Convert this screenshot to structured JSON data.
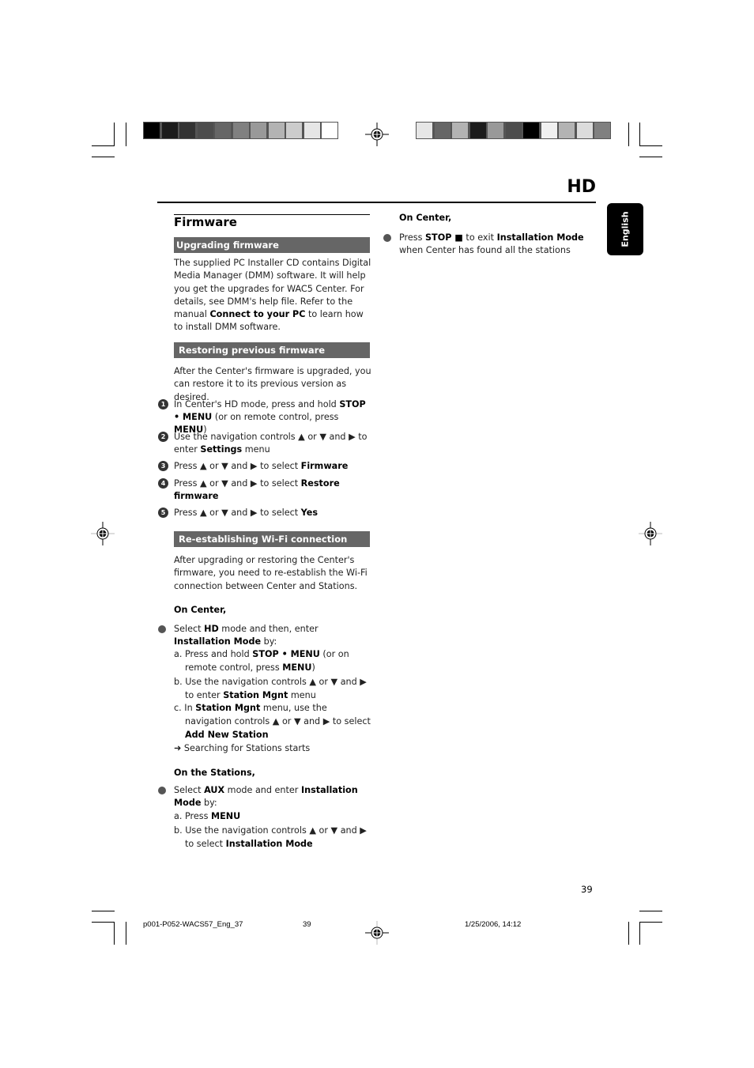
{
  "header": {
    "section_code": "HD",
    "language_tab": "English"
  },
  "color_bars": {
    "left": [
      "#000000",
      "#1c1c1c",
      "#333333",
      "#4d4d4d",
      "#666666",
      "#808080",
      "#999999",
      "#b3b3b3",
      "#cccccc",
      "#e6e6e6",
      "#ffffff"
    ],
    "right": [
      "#e6e6e6",
      "#666666",
      "#b3b3b3",
      "#1c1c1c",
      "#999999",
      "#4d4d4d",
      "#000000",
      "#f0f0f0",
      "#b3b3b3",
      "#dcdcdc",
      "#808080"
    ]
  },
  "left_column": {
    "title": "Firmware",
    "upgrading": {
      "heading": "Upgrading firmware",
      "text_1": "The supplied PC Installer CD contains Digital Media Manager (DMM) software.  It will help you get the upgrades for WAC5 Center. For details, see DMM's help file. Refer to the manual",
      "bold_1": "Connect to your PC",
      "text_2": "to learn how to install DMM software."
    },
    "restoring": {
      "heading": "Restoring previous firmware",
      "intro": "After the Center's firmware is upgraded, you can restore it to its previous version as desired.",
      "steps": [
        {
          "num": "1",
          "parts": [
            [
              "In Center's HD mode, press and hold ",
              false
            ],
            [
              "STOP • MENU",
              true
            ],
            [
              " (or on remote control, press ",
              false
            ],
            [
              "MENU",
              true
            ],
            [
              ")",
              false
            ]
          ]
        },
        {
          "num": "2",
          "parts": [
            [
              "Use the navigation controls ▲  or  ▼  and ▶ to enter ",
              false
            ],
            [
              "Settings",
              true
            ],
            [
              " menu",
              false
            ]
          ]
        },
        {
          "num": "3",
          "parts": [
            [
              "Press ▲  or  ▼  and ▶ to select ",
              false
            ],
            [
              "Firmware",
              true
            ]
          ]
        },
        {
          "num": "4",
          "parts": [
            [
              "Press ▲  or  ▼  and ▶ to select ",
              false
            ],
            [
              "Restore firmware",
              true
            ]
          ]
        },
        {
          "num": "5",
          "parts": [
            [
              "Press ▲  or  ▼  and ▶ to select ",
              false
            ],
            [
              "Yes",
              true
            ]
          ]
        }
      ]
    },
    "reestablishing": {
      "heading": "Re-establishing Wi-Fi connection",
      "intro": "After upgrading or restoring the Center's firmware, you need to re-establish the Wi-Fi connection between Center and Stations.",
      "on_center_label": "On Center,",
      "center_bullet": [
        [
          "Select ",
          false
        ],
        [
          "HD",
          true
        ],
        [
          " mode and then, enter ",
          false
        ],
        [
          "Installation Mode",
          true
        ],
        [
          " by:",
          false
        ]
      ],
      "center_substeps": [
        [
          [
            "a. Press and hold  ",
            false
          ],
          [
            "STOP • MENU",
            true
          ],
          [
            " (or on remote control, press ",
            false
          ],
          [
            "MENU",
            true
          ],
          [
            ")",
            false
          ]
        ],
        [
          [
            "b. Use the navigation controls ▲  or  ▼  and ▶ to enter ",
            false
          ],
          [
            "Station Mgnt",
            true
          ],
          [
            " menu",
            false
          ]
        ],
        [
          [
            "c.  In ",
            false
          ],
          [
            "Station Mgnt",
            true
          ],
          [
            " menu,  use the navigation controls ▲  or  ▼  and ▶ to select ",
            false
          ],
          [
            "Add New Station",
            true
          ]
        ]
      ],
      "center_result": "➜ Searching for Stations starts",
      "on_stations_label": "On the Stations,",
      "stations_bullet": [
        [
          "Select ",
          false
        ],
        [
          "AUX",
          true
        ],
        [
          " mode and enter ",
          false
        ],
        [
          "Installation Mode",
          true
        ],
        [
          " by:",
          false
        ]
      ],
      "stations_substeps": [
        [
          [
            "a. Press ",
            false
          ],
          [
            "MENU",
            true
          ]
        ],
        [
          [
            "b. Use the navigation controls ▲  or  ▼  and ▶ to select ",
            false
          ],
          [
            "Installation Mode",
            true
          ]
        ]
      ]
    }
  },
  "right_column": {
    "on_center_label": "On Center,",
    "bullet": [
      [
        "Press ",
        false
      ],
      [
        "STOP ■",
        true
      ],
      [
        " to exit ",
        false
      ],
      [
        "Installation Mode",
        true
      ],
      [
        " when Center has found all the stations",
        false
      ]
    ]
  },
  "page_number": "39",
  "footer": {
    "file_name": "p001-P052-WACS57_Eng_37",
    "page": "39",
    "timestamp": "1/25/2006, 14:12"
  }
}
